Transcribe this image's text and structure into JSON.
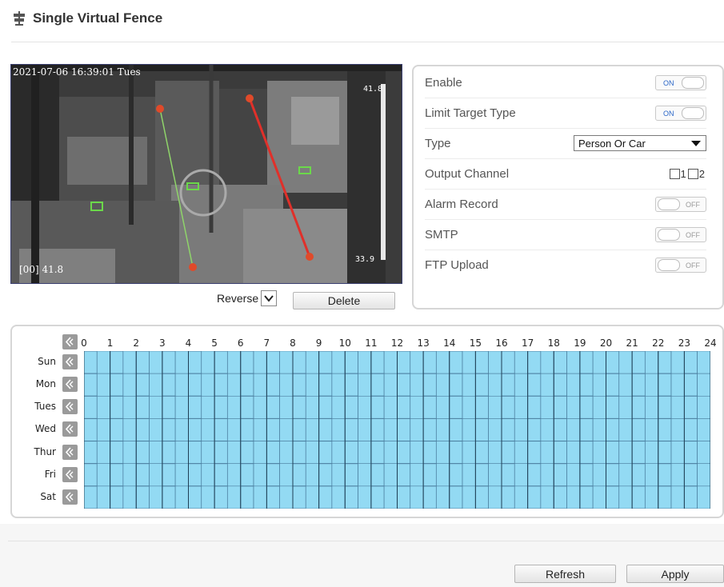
{
  "page": {
    "title": "Single Virtual Fence",
    "title_icon": "signpost-icon"
  },
  "video": {
    "timestamp": "2021-07-06 16:39:01 Tues",
    "temp_top_right": "41.8",
    "temp_bottom_right": "33.9",
    "bottom_left_readout": "[00] 41.8",
    "fence_lines": [
      {
        "color": "#8fd46a",
        "name": "green-fence-line"
      },
      {
        "color": "#e0302a",
        "name": "red-fence-line"
      }
    ],
    "marker_color": "#e04a2a"
  },
  "video_controls": {
    "reverse_label": "Reverse",
    "reverse_checked": true,
    "delete_label": "Delete"
  },
  "settings": {
    "enable": {
      "label": "Enable",
      "state": "ON"
    },
    "limit_target_type": {
      "label": "Limit Target Type",
      "state": "ON"
    },
    "type": {
      "label": "Type",
      "value": "Person Or Car"
    },
    "output_channel": {
      "label": "Output Channel",
      "channels": [
        "1",
        "2"
      ]
    },
    "alarm_record": {
      "label": "Alarm Record",
      "state": "OFF"
    },
    "smtp": {
      "label": "SMTP",
      "state": "OFF"
    },
    "ftp_upload": {
      "label": "FTP Upload",
      "state": "OFF"
    }
  },
  "schedule": {
    "days": [
      "Sun",
      "Mon",
      "Tues",
      "Wed",
      "Thur",
      "Fri",
      "Sat"
    ],
    "hours": [
      "0",
      "1",
      "2",
      "3",
      "4",
      "5",
      "6",
      "7",
      "8",
      "9",
      "10",
      "11",
      "12",
      "13",
      "14",
      "15",
      "16",
      "17",
      "18",
      "19",
      "20",
      "21",
      "22",
      "23",
      "24"
    ],
    "fill_color": "#93daf3",
    "all_selected": true
  },
  "footer": {
    "refresh_label": "Refresh",
    "apply_label": "Apply"
  }
}
